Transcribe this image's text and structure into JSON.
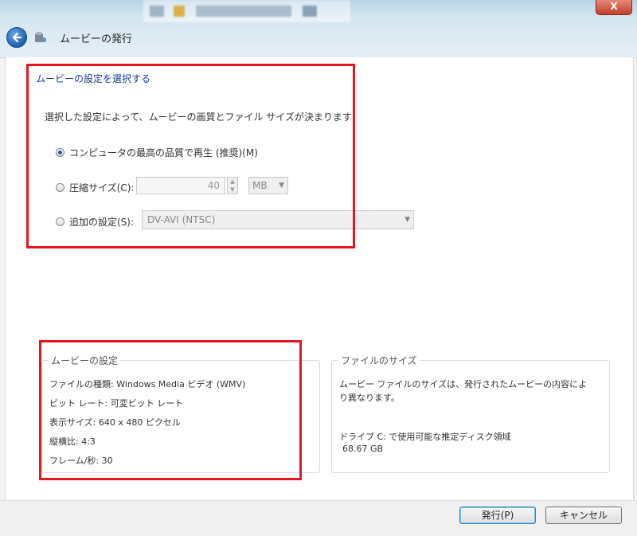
{
  "window": {
    "title": "ムービーの発行",
    "close_glyph": "X"
  },
  "main": {
    "instruction": "ムービーの設定を選択する",
    "description": "選択した設定によって、ムービーの画質とファイル サイズが決まります:",
    "options": [
      {
        "label": "コンピュータの最高の品質で再生 (推奨)(M)",
        "checked": true
      },
      {
        "label": "圧縮サイズ(C):",
        "checked": false
      },
      {
        "label": "追加の設定(S):",
        "checked": false
      }
    ],
    "size_value": "40",
    "size_unit": "MB",
    "preset_value": "DV-AVI (NTSC)"
  },
  "movie_settings": {
    "title": "ムービーの設定",
    "lines": [
      "ファイルの種類: Windows Media ビデオ (WMV)",
      "ビット レート: 可変ビット レート",
      "表示サイズ: 640 x 480 ピクセル",
      "縦横比: 4:3",
      "フレーム/秒: 30"
    ]
  },
  "file_size": {
    "title": "ファイルのサイズ",
    "line1": "ムービー ファイルのサイズは、発行されたムービーの内容によ",
    "line2": "り異なります。",
    "disk_label": "ドライブ C: で使用可能な推定ディスク領域",
    "disk_value": "68.67 GB"
  },
  "buttons": {
    "publish": "発行(P)",
    "cancel": "キャンセル"
  },
  "colors": {
    "highlight_box": "#e4171e",
    "instruction_text": "#1a3d96"
  }
}
